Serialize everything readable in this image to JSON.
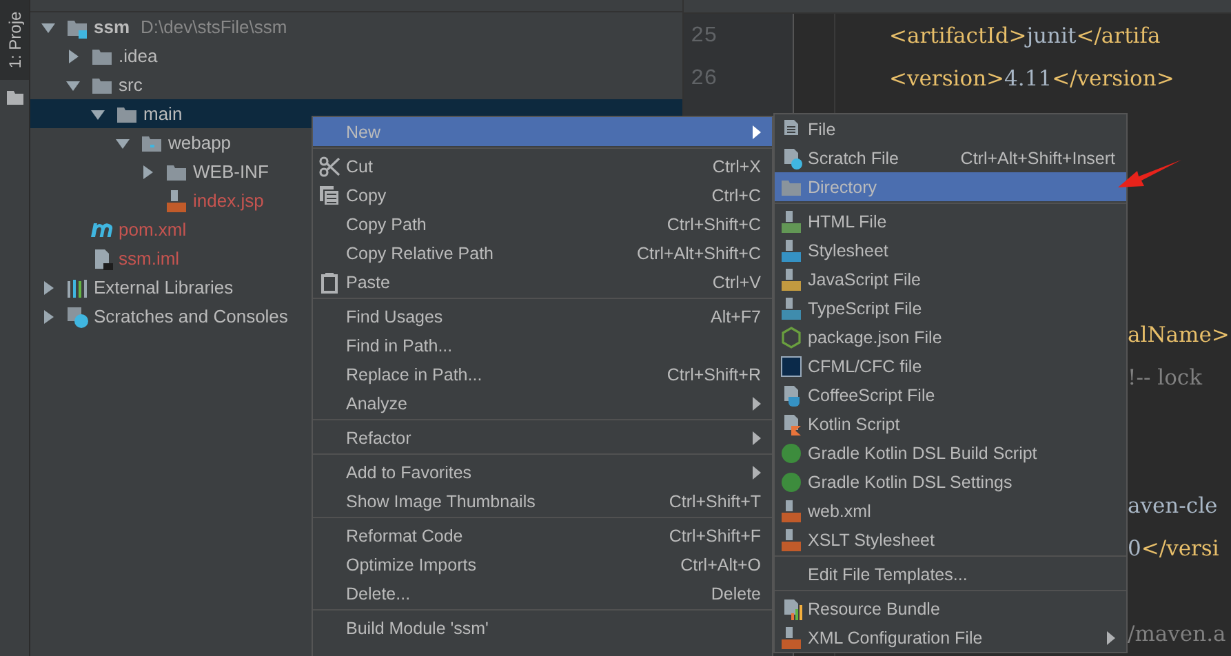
{
  "tool_strip": {
    "tab_label": "1: Proje"
  },
  "project_tree": {
    "items": [
      {
        "label": "ssm",
        "path": "D:\\dev\\stsFile\\ssm",
        "kind": "module",
        "expanded": true,
        "selected": false,
        "color": "#bbbbbb",
        "children": [
          {
            "label": ".idea",
            "kind": "folder",
            "expanded": false,
            "selected": false,
            "color": "#bbbbbb"
          },
          {
            "label": "src",
            "kind": "folder",
            "expanded": true,
            "selected": false,
            "color": "#bbbbbb",
            "children": [
              {
                "label": "main",
                "kind": "folder",
                "expanded": true,
                "selected": true,
                "color": "#bbbbbb",
                "children": [
                  {
                    "label": "webapp",
                    "kind": "webfolder",
                    "expanded": true,
                    "selected": false,
                    "color": "#bbbbbb",
                    "children": [
                      {
                        "label": "WEB-INF",
                        "kind": "folder",
                        "expanded": false,
                        "selected": false,
                        "color": "#bbbbbb"
                      },
                      {
                        "label": "index.jsp",
                        "kind": "jsp",
                        "selected": false,
                        "color": "#c75450"
                      }
                    ]
                  }
                ]
              }
            ]
          },
          {
            "label": "pom.xml",
            "kind": "maven",
            "selected": false,
            "color": "#c75450"
          },
          {
            "label": "ssm.iml",
            "kind": "iml",
            "selected": false,
            "color": "#c75450"
          }
        ]
      },
      {
        "label": "External Libraries",
        "kind": "libraries",
        "expanded": false,
        "selected": false,
        "color": "#bbbbbb"
      },
      {
        "label": "Scratches and Consoles",
        "kind": "scratches",
        "expanded": false,
        "selected": false,
        "color": "#bbbbbb"
      }
    ]
  },
  "editor": {
    "lines": [
      {
        "number": "25",
        "kind": "full",
        "segments": [
          {
            "kind": "tag",
            "text": "<artifactId>"
          },
          {
            "kind": "text",
            "text": "junit"
          },
          {
            "kind": "tag",
            "text": "</artifa"
          }
        ]
      },
      {
        "number": "26",
        "kind": "full",
        "segments": [
          {
            "kind": "tag",
            "text": "<version>"
          },
          {
            "kind": "number",
            "text": "4.11"
          },
          {
            "kind": "tag",
            "text": "</version>"
          }
        ]
      },
      {
        "kind": "blank"
      },
      {
        "kind": "blank"
      },
      {
        "kind": "blank"
      },
      {
        "kind": "blank"
      },
      {
        "kind": "blank"
      },
      {
        "kind": "fragment",
        "segments": [
          {
            "kind": "tag",
            "text": "alName>"
          }
        ]
      },
      {
        "kind": "fragment",
        "segments": [
          {
            "kind": "comment",
            "text": "!-- lock"
          }
        ]
      },
      {
        "kind": "blank"
      },
      {
        "kind": "blank"
      },
      {
        "kind": "fragment",
        "segments": [
          {
            "kind": "text",
            "text": "aven-cle"
          }
        ]
      },
      {
        "kind": "fragment",
        "segments": [
          {
            "kind": "number",
            "text": "0"
          },
          {
            "kind": "tag",
            "text": "</versi"
          }
        ]
      },
      {
        "kind": "blank"
      },
      {
        "kind": "fragment",
        "segments": [
          {
            "kind": "comment",
            "text": "/maven.a"
          }
        ]
      }
    ]
  },
  "context_menu": {
    "groups": [
      [
        {
          "label": "New",
          "kind": "plain",
          "submenu": true,
          "selected": true
        }
      ],
      [
        {
          "label": "Cut",
          "kind": "cut",
          "shortcut": "Ctrl+X",
          "submenu": false,
          "selected": false
        },
        {
          "label": "Copy",
          "kind": "copy",
          "shortcut": "Ctrl+C",
          "submenu": false,
          "selected": false
        },
        {
          "label": "Copy Path",
          "kind": "plain",
          "shortcut": "Ctrl+Shift+C",
          "submenu": false,
          "selected": false
        },
        {
          "label": "Copy Relative Path",
          "kind": "plain",
          "shortcut": "Ctrl+Alt+Shift+C",
          "submenu": false,
          "selected": false
        },
        {
          "label": "Paste",
          "kind": "paste",
          "shortcut": "Ctrl+V",
          "submenu": false,
          "selected": false
        }
      ],
      [
        {
          "label": "Find Usages",
          "kind": "plain",
          "shortcut": "Alt+F7",
          "submenu": false,
          "selected": false
        },
        {
          "label": "Find in Path...",
          "kind": "plain",
          "submenu": false,
          "selected": false
        },
        {
          "label": "Replace in Path...",
          "kind": "plain",
          "shortcut": "Ctrl+Shift+R",
          "submenu": false,
          "selected": false
        },
        {
          "label": "Analyze",
          "kind": "plain",
          "submenu": true,
          "selected": false
        }
      ],
      [
        {
          "label": "Refactor",
          "kind": "plain",
          "submenu": true,
          "selected": false
        }
      ],
      [
        {
          "label": "Add to Favorites",
          "kind": "plain",
          "submenu": true,
          "selected": false
        },
        {
          "label": "Show Image Thumbnails",
          "kind": "plain",
          "shortcut": "Ctrl+Shift+T",
          "submenu": false,
          "selected": false
        }
      ],
      [
        {
          "label": "Reformat Code",
          "kind": "plain",
          "shortcut": "Ctrl+Shift+F",
          "submenu": false,
          "selected": false
        },
        {
          "label": "Optimize Imports",
          "kind": "plain",
          "shortcut": "Ctrl+Alt+O",
          "submenu": false,
          "selected": false
        },
        {
          "label": "Delete...",
          "kind": "plain",
          "shortcut": "Delete",
          "submenu": false,
          "selected": false
        }
      ],
      [
        {
          "label": "Build Module 'ssm'",
          "kind": "plain",
          "submenu": false,
          "selected": false
        }
      ]
    ]
  },
  "new_submenu": {
    "groups": [
      [
        {
          "label": "File",
          "kind": "file",
          "submenu": false,
          "selected": false
        },
        {
          "label": "Scratch File",
          "kind": "scratch",
          "shortcut": "Ctrl+Alt+Shift+Insert",
          "submenu": false,
          "selected": false
        },
        {
          "label": "Directory",
          "kind": "folder",
          "submenu": false,
          "selected": true
        }
      ],
      [
        {
          "label": "HTML File",
          "kind": "html",
          "submenu": false,
          "selected": false
        },
        {
          "label": "Stylesheet",
          "kind": "css",
          "submenu": false,
          "selected": false
        },
        {
          "label": "JavaScript File",
          "kind": "js",
          "submenu": false,
          "selected": false
        },
        {
          "label": "TypeScript File",
          "kind": "ts",
          "submenu": false,
          "selected": false
        },
        {
          "label": "package.json File",
          "kind": "node",
          "submenu": false,
          "selected": false
        },
        {
          "label": "CFML/CFC file",
          "kind": "cf",
          "submenu": false,
          "selected": false
        },
        {
          "label": "CoffeeScript File",
          "kind": "coffee",
          "submenu": false,
          "selected": false
        },
        {
          "label": "Kotlin Script",
          "kind": "kotlin",
          "submenu": false,
          "selected": false
        },
        {
          "label": "Gradle Kotlin DSL Build Script",
          "kind": "gradle",
          "submenu": false,
          "selected": false
        },
        {
          "label": "Gradle Kotlin DSL Settings",
          "kind": "gradle",
          "submenu": false,
          "selected": false
        },
        {
          "label": "web.xml",
          "kind": "xml",
          "submenu": false,
          "selected": false
        },
        {
          "label": "XSLT Stylesheet",
          "kind": "xml",
          "submenu": false,
          "selected": false
        }
      ],
      [
        {
          "label": "Edit File Templates...",
          "kind": "plain",
          "submenu": false,
          "selected": false
        }
      ],
      [
        {
          "label": "Resource Bundle",
          "kind": "bundle",
          "submenu": false,
          "selected": false
        },
        {
          "label": "XML Configuration File",
          "kind": "xml",
          "submenu": true,
          "selected": false
        }
      ]
    ]
  }
}
